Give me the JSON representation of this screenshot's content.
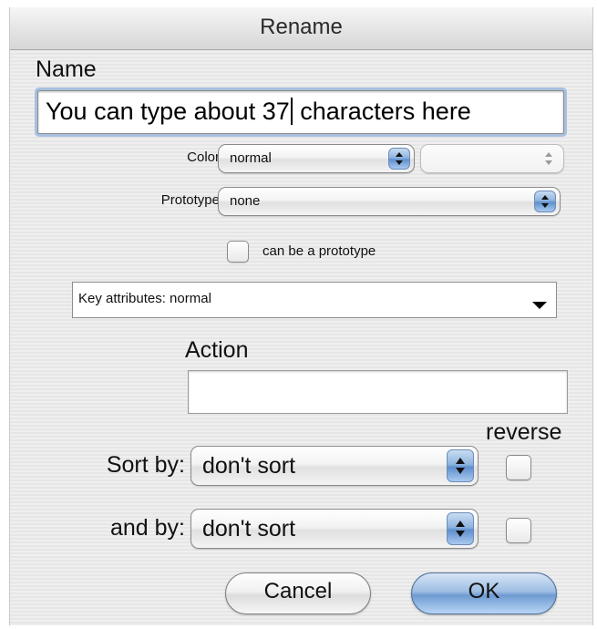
{
  "window": {
    "title": "Rename"
  },
  "name": {
    "label": "Name",
    "value_before_caret": "You can type about 37",
    "value_after_caret": " characters here"
  },
  "color": {
    "label": "Color",
    "selected": "normal",
    "secondary_selected": ""
  },
  "prototype": {
    "label": "Prototype",
    "selected": "none",
    "can_be_prototype_label": "can be a prototype",
    "can_be_prototype_checked": false
  },
  "key_attributes": {
    "label": "Key attributes: normal"
  },
  "action": {
    "label": "Action",
    "value": ""
  },
  "sort": {
    "reverse_label": "reverse",
    "sort_by_label": "Sort by:",
    "sort_by_selected": "don't sort",
    "sort_by_reverse": false,
    "and_by_label": "and by:",
    "and_by_selected": "don't sort",
    "and_by_reverse": false
  },
  "buttons": {
    "cancel": "Cancel",
    "ok": "OK"
  },
  "icons": {
    "popup_arrows": "up-down-arrows-icon",
    "dropdown_triangle": "triangle-down-icon"
  },
  "colors": {
    "default_button_blue": "#6f9bd2",
    "focus_ring": "#a7c0e0"
  }
}
